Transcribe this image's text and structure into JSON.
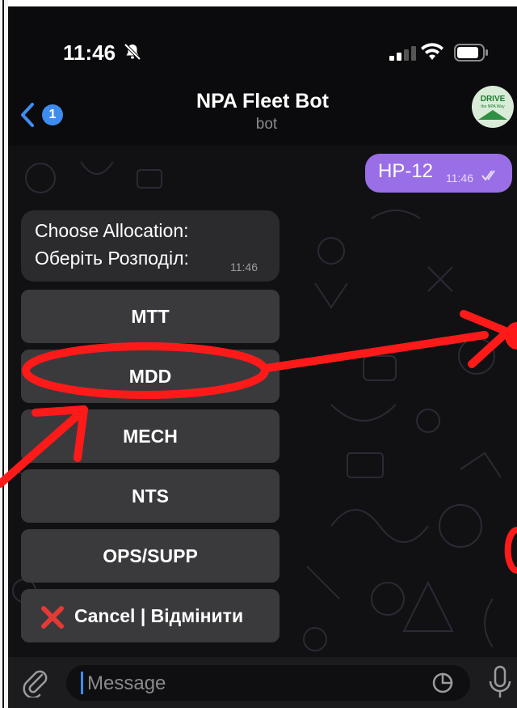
{
  "status_bar": {
    "time": "11:46"
  },
  "header": {
    "back_badge": "1",
    "title": "NPA Fleet Bot",
    "subtitle": "bot",
    "avatar_text": "DRIVE",
    "avatar_subtext": "the NPA Way"
  },
  "messages": {
    "outgoing": {
      "text": "HP-12",
      "time": "11:46"
    },
    "incoming": {
      "line1": "Choose Allocation:",
      "line2": "Оберіть Розподіл:",
      "time": "11:46"
    }
  },
  "keyboard": {
    "buttons": [
      "MTT",
      "MDD",
      "MECH",
      "NTS",
      "OPS/SUPP"
    ],
    "cancel_label": "Cancel | Відмінити"
  },
  "input_bar": {
    "placeholder": "Message"
  },
  "colors": {
    "accent": "#3f8cf1",
    "outgoing_bubble": "#9a6ee6",
    "annotation": "#ff1a1a",
    "cancel_icon": "#e53935"
  },
  "icons": [
    "bell-slash-icon",
    "signal-icon",
    "wifi-icon",
    "battery-icon",
    "chevron-left-icon",
    "paperclip-icon",
    "sticker-icon",
    "microphone-icon",
    "red-x-icon",
    "double-check-icon"
  ]
}
